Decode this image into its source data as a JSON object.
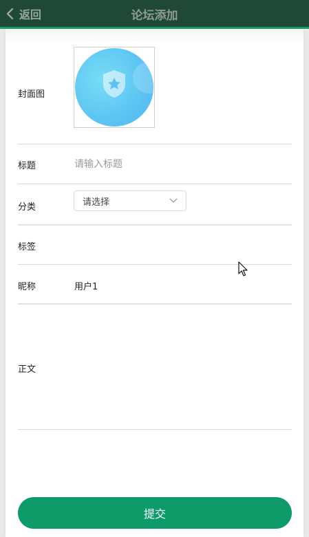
{
  "header": {
    "back_label": "返回",
    "title": "论坛添加"
  },
  "form": {
    "cover": {
      "label": "封面图"
    },
    "title_field": {
      "label": "标题",
      "placeholder": "请输入标题"
    },
    "category": {
      "label": "分类",
      "selected": "请选择"
    },
    "tags": {
      "label": "标签"
    },
    "nickname": {
      "label": "昵称",
      "value": "用户1"
    },
    "body": {
      "label": "正文"
    }
  },
  "actions": {
    "submit_label": "提交"
  },
  "colors": {
    "header_bg": "#1f4936",
    "accent": "#0e9b69"
  }
}
